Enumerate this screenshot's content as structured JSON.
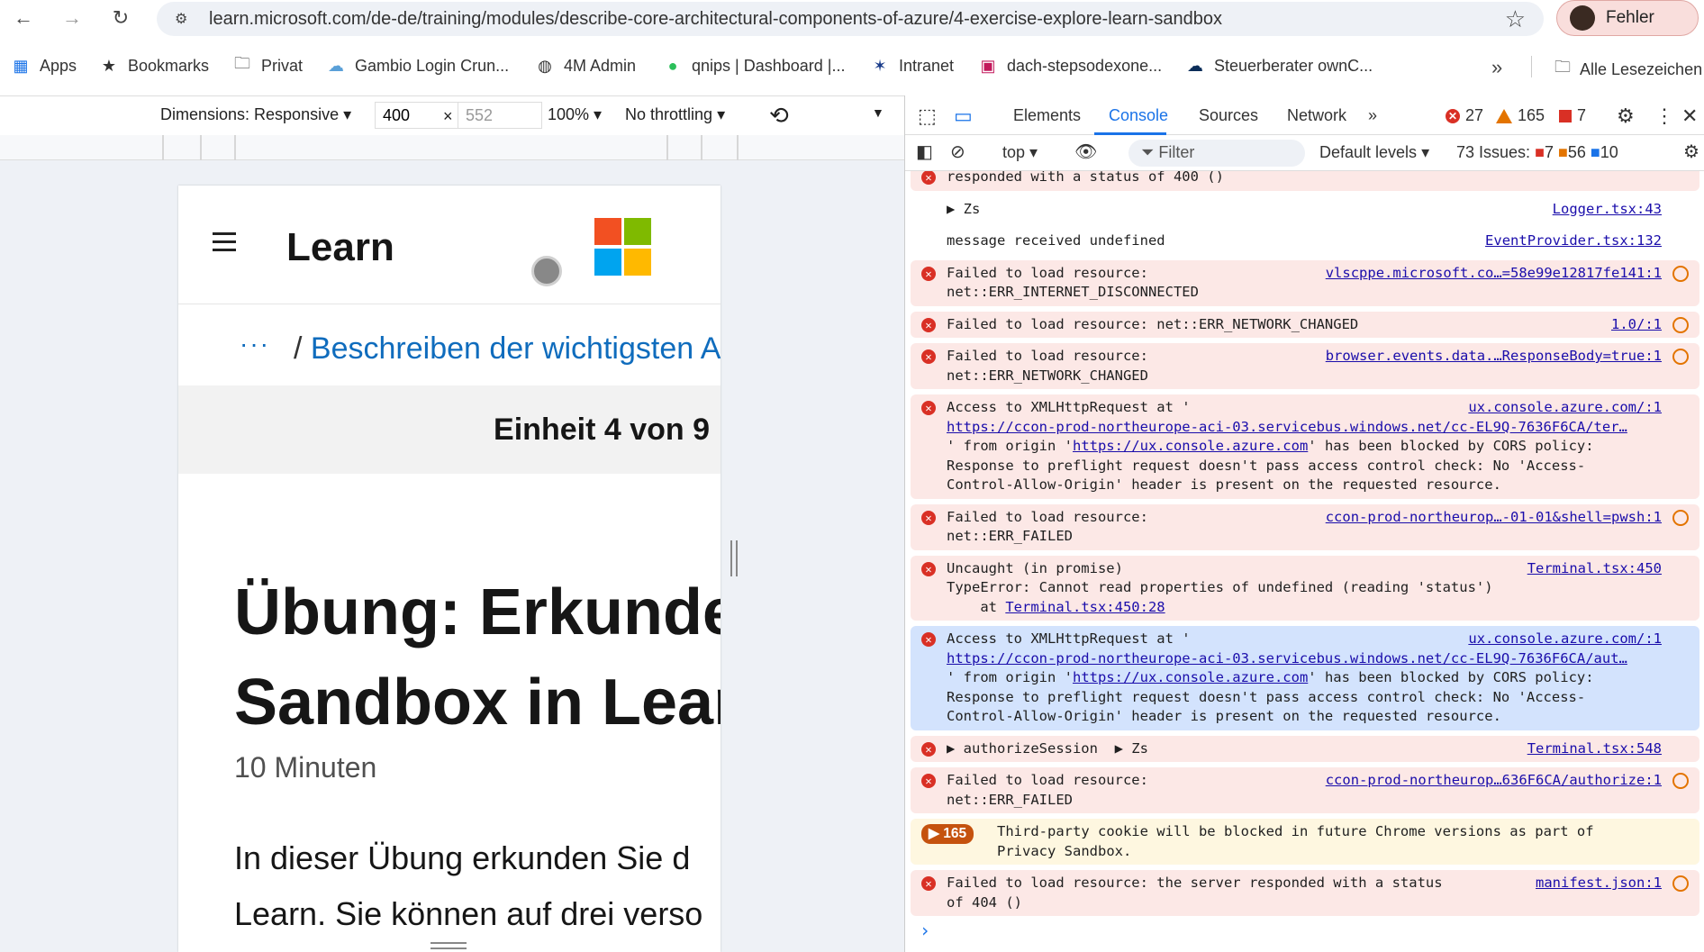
{
  "browser": {
    "url": "learn.microsoft.com/de-de/training/modules/describe-core-architectural-components-of-azure/4-exercise-explore-learn-sandbox",
    "profile_label": "Fehler",
    "bookmarks": [
      "Apps",
      "Bookmarks",
      "Privat",
      "Gambio Login Crun...",
      "4M Admin",
      "qnips | Dashboard |...",
      "Intranet",
      "dach-stepsodexone...",
      "Steuerberater ownC..."
    ],
    "bookmarks_all": "Alle Lesezeichen"
  },
  "device_toolbar": {
    "dimensions": "Dimensions: Responsive",
    "width": "400",
    "height": "552",
    "times": "×",
    "zoom": "100%",
    "throttle": "No throttling"
  },
  "page": {
    "brand": "Learn",
    "breadcrumb_dots": "···",
    "breadcrumb_slash": "/",
    "breadcrumb_text": "Beschreiben der wichtigsten A",
    "unit_label": "Einheit 4 von 9",
    "title_line1": "Übung: Erkunde",
    "title_line2": "Sandbox in Lear",
    "duration": "10 Minuten",
    "para_line1": "In dieser Übung erkunden Sie d",
    "para_line2": "Learn. Sie können auf drei verso",
    "ms_colors": [
      "#f25022",
      "#7fba00",
      "#00a4ef",
      "#ffb900"
    ]
  },
  "devtools": {
    "tabs": [
      "Elements",
      "Console",
      "Sources",
      "Network"
    ],
    "errors": "27",
    "warnings": "165",
    "issues_flag": "7",
    "context": "top",
    "filter_placeholder": "Filter",
    "levels": "Default levels",
    "issues_label": "73 Issues:",
    "issues_err": "7",
    "issues_warn": "56",
    "issues_info": "10"
  },
  "console": [
    {
      "type": "error",
      "partial": true,
      "msg": "responded with a status of 400 ()",
      "src": ""
    },
    {
      "type": "plain",
      "msg": "▶ Zs",
      "src": "Logger.tsx:43"
    },
    {
      "type": "plain",
      "msg": "message received undefined",
      "src": "EventProvider.tsx:132"
    },
    {
      "type": "error",
      "msg": "Failed to load resource:\nnet::ERR_INTERNET_DISCONNECTED",
      "src": "vlscppe.microsoft.co…=58e99e12817fe141:1",
      "net": true
    },
    {
      "type": "error",
      "msg": "Failed to load resource: net::ERR_NETWORK_CHANGED",
      "src": "1.0/:1",
      "net": true
    },
    {
      "type": "error",
      "msg": "Failed to load resource:\nnet::ERR_NETWORK_CHANGED",
      "src": "browser.events.data.…ResponseBody=true:1",
      "net": true
    },
    {
      "type": "error",
      "msg": "Access to XMLHttpRequest at '\nhttps://ccon-prod-northeurope-aci-03.servicebus.windows.net/cc-EL9Q-7636F6CA/ter…\n' from origin 'https://ux.console.azure.com' has been blocked by CORS policy:\nResponse to preflight request doesn't pass access control check: No 'Access-\nControl-Allow-Origin' header is present on the requested resource.",
      "src": "ux.console.azure.com/:1"
    },
    {
      "type": "error",
      "msg": "Failed to load resource:\nnet::ERR_FAILED",
      "src": "ccon-prod-northeurop…-01-01&shell=pwsh:1",
      "net": true
    },
    {
      "type": "error",
      "msg": "Uncaught (in promise)\nTypeError: Cannot read properties of undefined (reading 'status')\n    at Terminal.tsx:450:28",
      "src": "Terminal.tsx:450"
    },
    {
      "type": "sel",
      "msg": "Access to XMLHttpRequest at '\nhttps://ccon-prod-northeurope-aci-03.servicebus.windows.net/cc-EL9Q-7636F6CA/aut…\n' from origin 'https://ux.console.azure.com' has been blocked by CORS policy:\nResponse to preflight request doesn't pass access control check: No 'Access-\nControl-Allow-Origin' header is present on the requested resource.",
      "src": "ux.console.azure.com/:1"
    },
    {
      "type": "error",
      "msg": "▶ authorizeSession  ▶ Zs",
      "src": "Terminal.tsx:548"
    },
    {
      "type": "error",
      "msg": "Failed to load resource:\nnet::ERR_FAILED",
      "src": "ccon-prod-northeurop…636F6CA/authorize:1",
      "net": true
    },
    {
      "type": "warn",
      "badge": "▶ 165",
      "msg": "Third-party cookie will be blocked in future Chrome versions as part of\nPrivacy Sandbox.",
      "src": ""
    },
    {
      "type": "error",
      "msg": "Failed to load resource: the server responded with a status\nof 404 ()",
      "src": "manifest.json:1",
      "net": true
    }
  ]
}
